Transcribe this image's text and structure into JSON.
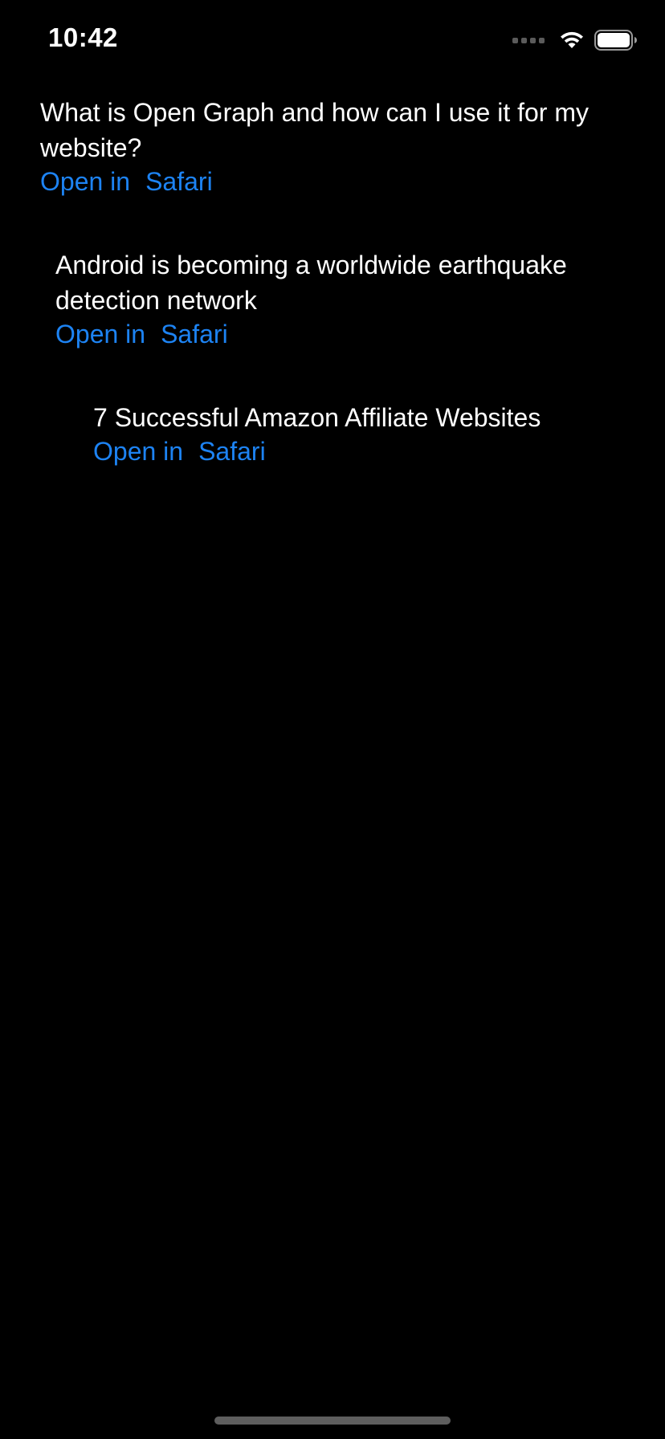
{
  "status_bar": {
    "time": "10:42",
    "icons": [
      "cellular-signal-icon",
      "wifi-icon",
      "battery-icon"
    ]
  },
  "items": [
    {
      "title": "What is Open Graph and how can I use it for my website?",
      "link_open": "Open in",
      "link_target": "Safari"
    },
    {
      "title": "Android is becoming a worldwide earthquake detection network",
      "link_open": "Open in",
      "link_target": "Safari"
    },
    {
      "title": "7 Successful Amazon Affiliate Websites",
      "link_open": "Open in",
      "link_target": "Safari"
    }
  ],
  "colors": {
    "background": "#000000",
    "text": "#ffffff",
    "link": "#1d83f3"
  }
}
